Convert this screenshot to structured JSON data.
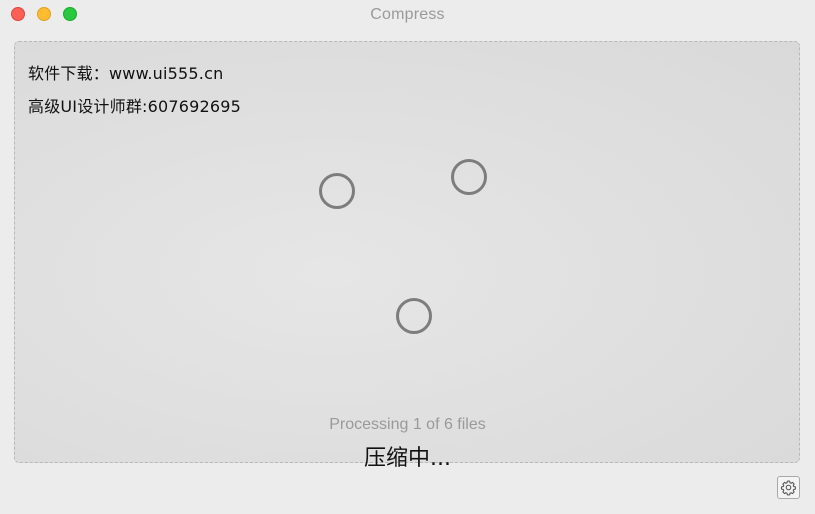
{
  "window": {
    "title": "Compress"
  },
  "watermark": {
    "line1": "软件下载：www.ui555.cn",
    "line2": "高级UI设计师群:607692695"
  },
  "progress": {
    "status": "Processing 1 of 6 files",
    "label": "压缩中..."
  },
  "icons": {
    "settings": "gear-icon",
    "spinner": "loading-spinner"
  },
  "colors": {
    "close": "#fe5f57",
    "minimize": "#febc2e",
    "maximize": "#28c840"
  }
}
